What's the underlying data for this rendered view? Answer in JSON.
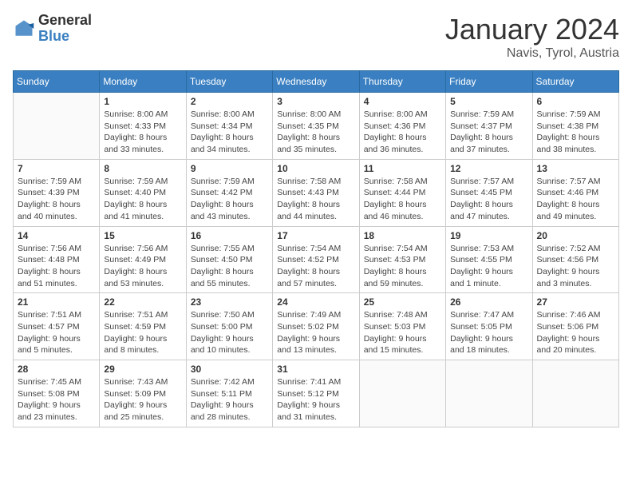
{
  "header": {
    "logo_general": "General",
    "logo_blue": "Blue",
    "month": "January 2024",
    "location": "Navis, Tyrol, Austria"
  },
  "days_of_week": [
    "Sunday",
    "Monday",
    "Tuesday",
    "Wednesday",
    "Thursday",
    "Friday",
    "Saturday"
  ],
  "weeks": [
    [
      {
        "day": "",
        "info": ""
      },
      {
        "day": "1",
        "info": "Sunrise: 8:00 AM\nSunset: 4:33 PM\nDaylight: 8 hours\nand 33 minutes."
      },
      {
        "day": "2",
        "info": "Sunrise: 8:00 AM\nSunset: 4:34 PM\nDaylight: 8 hours\nand 34 minutes."
      },
      {
        "day": "3",
        "info": "Sunrise: 8:00 AM\nSunset: 4:35 PM\nDaylight: 8 hours\nand 35 minutes."
      },
      {
        "day": "4",
        "info": "Sunrise: 8:00 AM\nSunset: 4:36 PM\nDaylight: 8 hours\nand 36 minutes."
      },
      {
        "day": "5",
        "info": "Sunrise: 7:59 AM\nSunset: 4:37 PM\nDaylight: 8 hours\nand 37 minutes."
      },
      {
        "day": "6",
        "info": "Sunrise: 7:59 AM\nSunset: 4:38 PM\nDaylight: 8 hours\nand 38 minutes."
      }
    ],
    [
      {
        "day": "7",
        "info": "Sunrise: 7:59 AM\nSunset: 4:39 PM\nDaylight: 8 hours\nand 40 minutes."
      },
      {
        "day": "8",
        "info": "Sunrise: 7:59 AM\nSunset: 4:40 PM\nDaylight: 8 hours\nand 41 minutes."
      },
      {
        "day": "9",
        "info": "Sunrise: 7:59 AM\nSunset: 4:42 PM\nDaylight: 8 hours\nand 43 minutes."
      },
      {
        "day": "10",
        "info": "Sunrise: 7:58 AM\nSunset: 4:43 PM\nDaylight: 8 hours\nand 44 minutes."
      },
      {
        "day": "11",
        "info": "Sunrise: 7:58 AM\nSunset: 4:44 PM\nDaylight: 8 hours\nand 46 minutes."
      },
      {
        "day": "12",
        "info": "Sunrise: 7:57 AM\nSunset: 4:45 PM\nDaylight: 8 hours\nand 47 minutes."
      },
      {
        "day": "13",
        "info": "Sunrise: 7:57 AM\nSunset: 4:46 PM\nDaylight: 8 hours\nand 49 minutes."
      }
    ],
    [
      {
        "day": "14",
        "info": "Sunrise: 7:56 AM\nSunset: 4:48 PM\nDaylight: 8 hours\nand 51 minutes."
      },
      {
        "day": "15",
        "info": "Sunrise: 7:56 AM\nSunset: 4:49 PM\nDaylight: 8 hours\nand 53 minutes."
      },
      {
        "day": "16",
        "info": "Sunrise: 7:55 AM\nSunset: 4:50 PM\nDaylight: 8 hours\nand 55 minutes."
      },
      {
        "day": "17",
        "info": "Sunrise: 7:54 AM\nSunset: 4:52 PM\nDaylight: 8 hours\nand 57 minutes."
      },
      {
        "day": "18",
        "info": "Sunrise: 7:54 AM\nSunset: 4:53 PM\nDaylight: 8 hours\nand 59 minutes."
      },
      {
        "day": "19",
        "info": "Sunrise: 7:53 AM\nSunset: 4:55 PM\nDaylight: 9 hours\nand 1 minute."
      },
      {
        "day": "20",
        "info": "Sunrise: 7:52 AM\nSunset: 4:56 PM\nDaylight: 9 hours\nand 3 minutes."
      }
    ],
    [
      {
        "day": "21",
        "info": "Sunrise: 7:51 AM\nSunset: 4:57 PM\nDaylight: 9 hours\nand 5 minutes."
      },
      {
        "day": "22",
        "info": "Sunrise: 7:51 AM\nSunset: 4:59 PM\nDaylight: 9 hours\nand 8 minutes."
      },
      {
        "day": "23",
        "info": "Sunrise: 7:50 AM\nSunset: 5:00 PM\nDaylight: 9 hours\nand 10 minutes."
      },
      {
        "day": "24",
        "info": "Sunrise: 7:49 AM\nSunset: 5:02 PM\nDaylight: 9 hours\nand 13 minutes."
      },
      {
        "day": "25",
        "info": "Sunrise: 7:48 AM\nSunset: 5:03 PM\nDaylight: 9 hours\nand 15 minutes."
      },
      {
        "day": "26",
        "info": "Sunrise: 7:47 AM\nSunset: 5:05 PM\nDaylight: 9 hours\nand 18 minutes."
      },
      {
        "day": "27",
        "info": "Sunrise: 7:46 AM\nSunset: 5:06 PM\nDaylight: 9 hours\nand 20 minutes."
      }
    ],
    [
      {
        "day": "28",
        "info": "Sunrise: 7:45 AM\nSunset: 5:08 PM\nDaylight: 9 hours\nand 23 minutes."
      },
      {
        "day": "29",
        "info": "Sunrise: 7:43 AM\nSunset: 5:09 PM\nDaylight: 9 hours\nand 25 minutes."
      },
      {
        "day": "30",
        "info": "Sunrise: 7:42 AM\nSunset: 5:11 PM\nDaylight: 9 hours\nand 28 minutes."
      },
      {
        "day": "31",
        "info": "Sunrise: 7:41 AM\nSunset: 5:12 PM\nDaylight: 9 hours\nand 31 minutes."
      },
      {
        "day": "",
        "info": ""
      },
      {
        "day": "",
        "info": ""
      },
      {
        "day": "",
        "info": ""
      }
    ]
  ]
}
